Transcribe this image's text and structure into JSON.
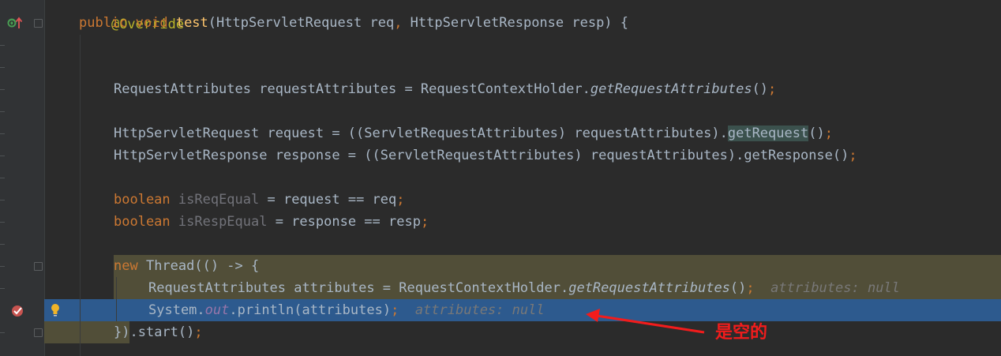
{
  "editor": {
    "lines": {
      "annotation": "@Override",
      "sig_kw": "public void ",
      "sig_name": "test",
      "sig_open": "(HttpServletRequest req",
      "sig_comma": ",",
      "sig_rest": " HttpServletResponse resp) {",
      "l4_a": "RequestAttributes requestAttributes = RequestContextHolder.",
      "l4_call": "getRequestAttributes",
      "l4_b": "()",
      "semi": ";",
      "l6_a": "HttpServletRequest request = ((ServletRequestAttributes) requestAttributes).",
      "l6_call": "getRequest",
      "l6_b": "()",
      "l7_a": "HttpServletResponse response = ((ServletRequestAttributes) requestAttributes).getResponse()",
      "bool_kw": "boolean ",
      "l9_var": "isReqEqual",
      "l9_b": " = request == req",
      "l10_var": "isRespEqual",
      "l10_b": " = response == resp",
      "new_kw": "new ",
      "l12_b": "Thread(() -> {",
      "l13_a": "RequestAttributes attributes = RequestContextHolder.",
      "l13_call": "getRequestAttributes",
      "l13_b": "()",
      "l13_hint": "attributes: null",
      "l14_a": "System.",
      "l14_out": "out",
      "l14_b": ".println(attributes)",
      "l14_hint": "attributes: null",
      "l15_a": "})",
      "l15_b": ".start()"
    }
  },
  "annotation_note": "是空的",
  "colors": {
    "background": "#2b2b2b",
    "keyword": "#cc7832",
    "method": "#ffc66d",
    "current_line": "#2d5a8e",
    "lambda_highlight": "#514e38",
    "arrow": "#f21c1c"
  },
  "icons": {
    "override_marker": "override-up-arrow-icon",
    "breakpoint": "breakpoint-check-icon",
    "intention": "lightbulb-icon"
  }
}
